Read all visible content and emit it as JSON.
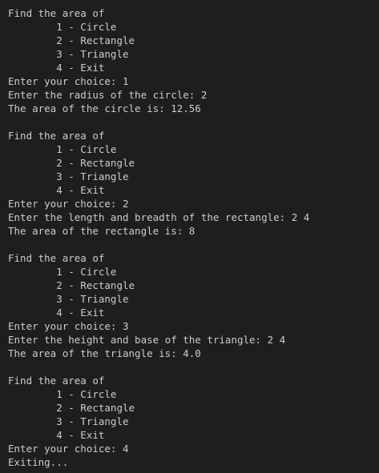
{
  "terminal": {
    "colors": {
      "background": "#1e1e1e",
      "text": "#cccccc"
    },
    "lines": [
      "Find the area of",
      "        1 - Circle",
      "        2 - Rectangle",
      "        3 - Triangle",
      "        4 - Exit",
      "Enter your choice: 1",
      "Enter the radius of the circle: 2",
      "The area of the circle is: 12.56",
      "",
      "Find the area of",
      "        1 - Circle",
      "        2 - Rectangle",
      "        3 - Triangle",
      "        4 - Exit",
      "Enter your choice: 2",
      "Enter the length and breadth of the rectangle: 2 4",
      "The area of the rectangle is: 8",
      "",
      "Find the area of",
      "        1 - Circle",
      "        2 - Rectangle",
      "        3 - Triangle",
      "        4 - Exit",
      "Enter your choice: 3",
      "Enter the height and base of the triangle: 2 4",
      "The area of the triangle is: 4.0",
      "",
      "Find the area of",
      "        1 - Circle",
      "        2 - Rectangle",
      "        3 - Triangle",
      "        4 - Exit",
      "Enter your choice: 4",
      "Exiting..."
    ]
  }
}
